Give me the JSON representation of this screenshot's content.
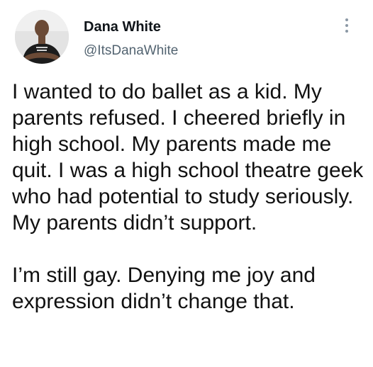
{
  "author": {
    "display_name": "Dana White",
    "handle": "@ItsDanaWhite",
    "avatar_icon": "profile-photo"
  },
  "menu": {
    "icon": "more-vertical-icon"
  },
  "tweet": {
    "paragraph_1": "I wanted to do ballet as a kid. My parents refused. I cheered briefly in high school. My parents made me quit. I was a high school theatre geek who had potential to study seriously. My parents didn’t support.",
    "paragraph_2": "I’m still gay. Denying me joy and expression didn’t change that."
  },
  "colors": {
    "name_text": "#0f1419",
    "handle_text": "#536471",
    "body_text": "#111111",
    "menu_dots": "#8b98a5",
    "background": "#ffffff"
  }
}
